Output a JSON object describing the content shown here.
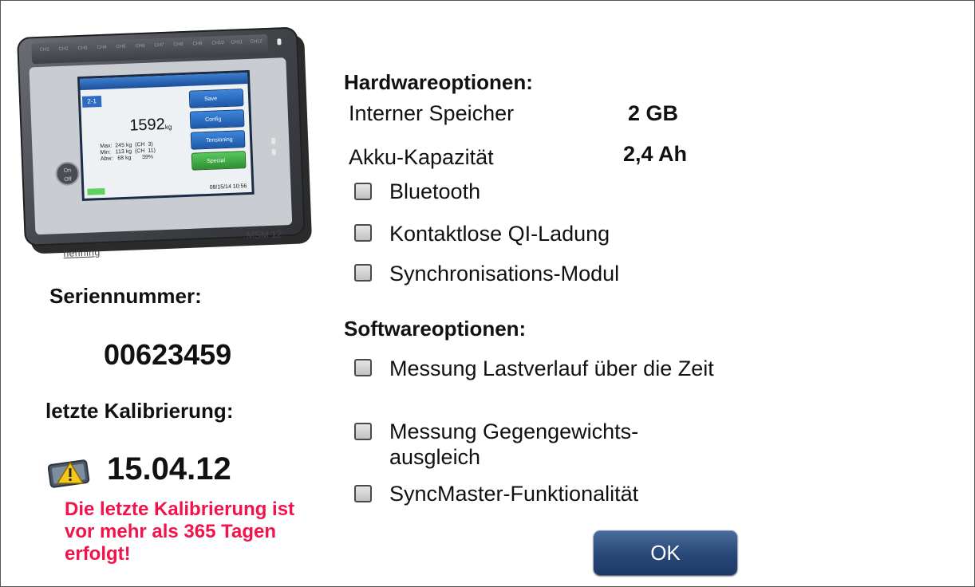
{
  "device": {
    "channels": [
      "CH1",
      "CH2",
      "CH3",
      "CH4",
      "CH5",
      "CH6",
      "CH7",
      "CH8",
      "CH9",
      "CH10",
      "CH11",
      "CH12"
    ],
    "screen_badge": "2-1",
    "screen_value": "1592",
    "screen_unit": "kg",
    "screen_info": "Max:  245 kg  (CH  3)\nMin:   113 kg  (CH  11)\nAbw:   68 kg       39%",
    "screen_buttons": [
      "Save",
      "Config",
      "Tensioning",
      "Special"
    ],
    "screen_date": "08/15/14 10:56",
    "power_label": "On\nOff",
    "brand": "henning",
    "model": "MSM 12"
  },
  "left": {
    "serial_label": "Seriennummer:",
    "serial_value": "00623459",
    "calibration_label": "letzte Kalibrierung:",
    "calibration_date": "15.04.12",
    "warning": "Die letzte Kalibrierung ist vor mehr als 365 Tagen erfolgt!"
  },
  "hardware": {
    "title": "Hardwareoptionen:",
    "storage_label": "Interner Speicher",
    "storage_value": "2 GB",
    "battery_label": "Akku-Kapazität",
    "battery_value": "2,4 Ah",
    "options": [
      {
        "label": "Bluetooth",
        "checked": false
      },
      {
        "label": "Kontaktlose QI-Ladung",
        "checked": false
      },
      {
        "label": "Synchronisations-Modul",
        "checked": false
      }
    ]
  },
  "software": {
    "title": "Softwareoptionen:",
    "options": [
      {
        "label": "Messung Lastverlauf über die Zeit",
        "checked": false
      },
      {
        "label": "Messung Gegengewichts-ausgleich",
        "checked": false
      },
      {
        "label": "SyncMaster-Funktionalität",
        "checked": false
      }
    ]
  },
  "ok_label": "OK",
  "colors": {
    "warning": "#f2134a",
    "button": "#2a4a7a"
  },
  "icons": {
    "calibration_warning": "warning-triangle-icon"
  }
}
